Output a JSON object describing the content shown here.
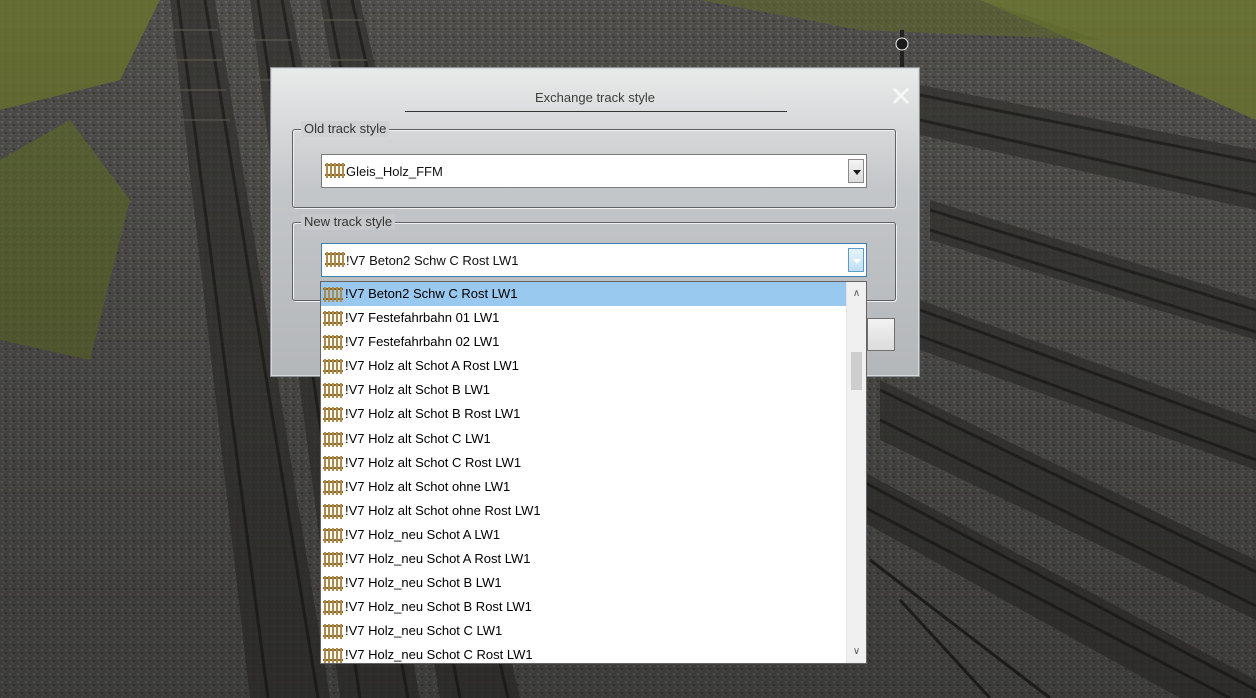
{
  "dialog": {
    "title": "Exchange track style",
    "close_icon": "close-icon"
  },
  "old_group": {
    "label": "Old track style",
    "value": "Gleis_Holz_FFM"
  },
  "new_group": {
    "label": "New track style",
    "value": "!V7 Beton2 Schw C Rost LW1"
  },
  "dropdown": {
    "selected_index": 0,
    "items": [
      "!V7 Beton2 Schw C Rost LW1",
      "!V7 Festefahrbahn 01 LW1",
      "!V7 Festefahrbahn 02 LW1",
      "!V7 Holz alt Schot A Rost LW1",
      "!V7 Holz alt Schot B LW1",
      "!V7 Holz alt Schot B Rost LW1",
      "!V7 Holz alt Schot C LW1",
      "!V7 Holz alt Schot C Rost LW1",
      "!V7 Holz alt Schot ohne LW1",
      "!V7 Holz alt Schot ohne Rost LW1",
      "!V7 Holz_neu Schot A LW1",
      "!V7 Holz_neu Schot A Rost LW1",
      "!V7 Holz_neu Schot B LW1",
      "!V7 Holz_neu Schot B Rost LW1",
      "!V7 Holz_neu Schot C LW1",
      "!V7 Holz_neu Schot C Rost LW1"
    ],
    "item_icon": "track-icon",
    "scroll_up_icon": "chevron-up-icon",
    "scroll_down_icon": "chevron-down-icon"
  },
  "colors": {
    "selection": "#99c9ef",
    "dialog_top": "#e9eaea",
    "dialog_bottom": "#b4b7b9",
    "grass": "#7c8a3a",
    "gravel": "#5a5956"
  }
}
